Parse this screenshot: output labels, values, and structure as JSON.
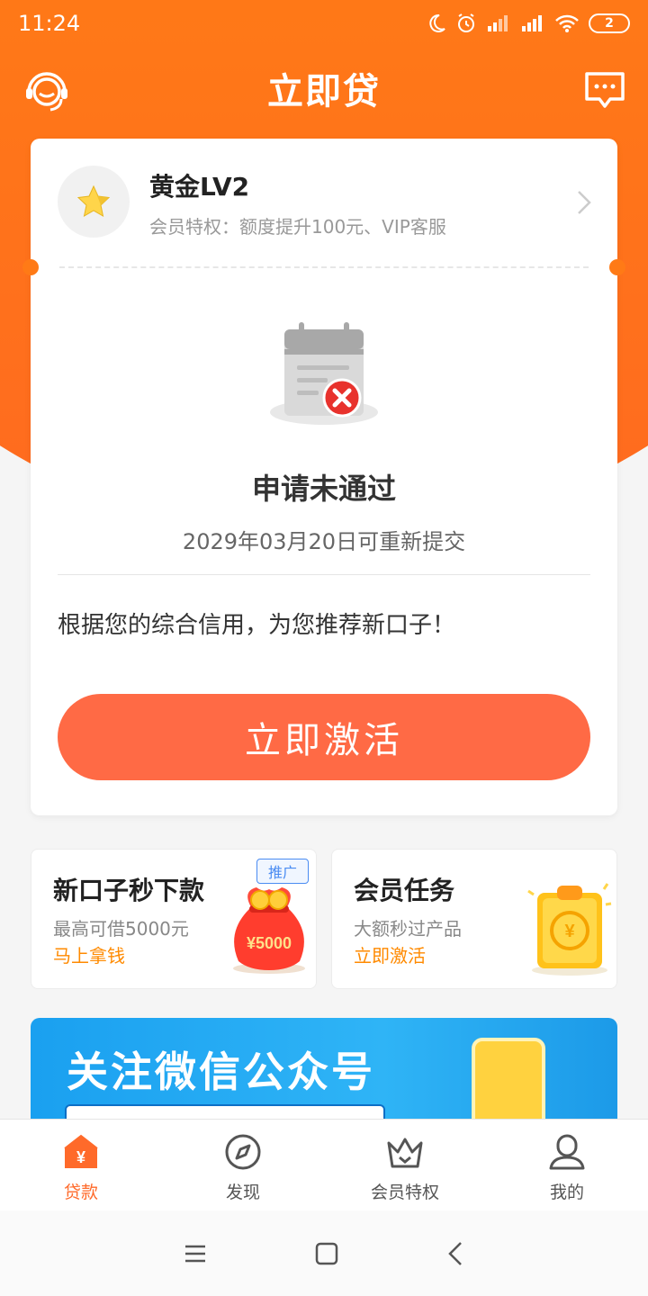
{
  "status_bar": {
    "time": "11:24",
    "battery": "2"
  },
  "header": {
    "title": "立即贷"
  },
  "member": {
    "level": "黄金LV2",
    "benefit": "会员特权：额度提升100元、VIP客服"
  },
  "status": {
    "title": "申请未通过",
    "resubmit_date": "2029年03月20日可重新提交"
  },
  "recommend_text": "根据您的综合信用，为您推荐新口子！",
  "activate_button": "立即激活",
  "promos": [
    {
      "title": "新口子秒下款",
      "subtitle": "最高可借5000元",
      "link": "马上拿钱",
      "ad_tag": "推广",
      "bag_amount": "¥5000"
    },
    {
      "title": "会员任务",
      "subtitle": "大额秒过产品",
      "link": "立即激活"
    }
  ],
  "banner": {
    "title": "关注微信公众号"
  },
  "tabs": [
    {
      "label": "贷款",
      "active": true
    },
    {
      "label": "发现",
      "active": false
    },
    {
      "label": "会员特权",
      "active": false
    },
    {
      "label": "我的",
      "active": false
    }
  ],
  "colors": {
    "primary": "#ff7a16",
    "button": "#ff6a45",
    "link": "#ff8a00",
    "tab_active": "#ff6a2a"
  }
}
